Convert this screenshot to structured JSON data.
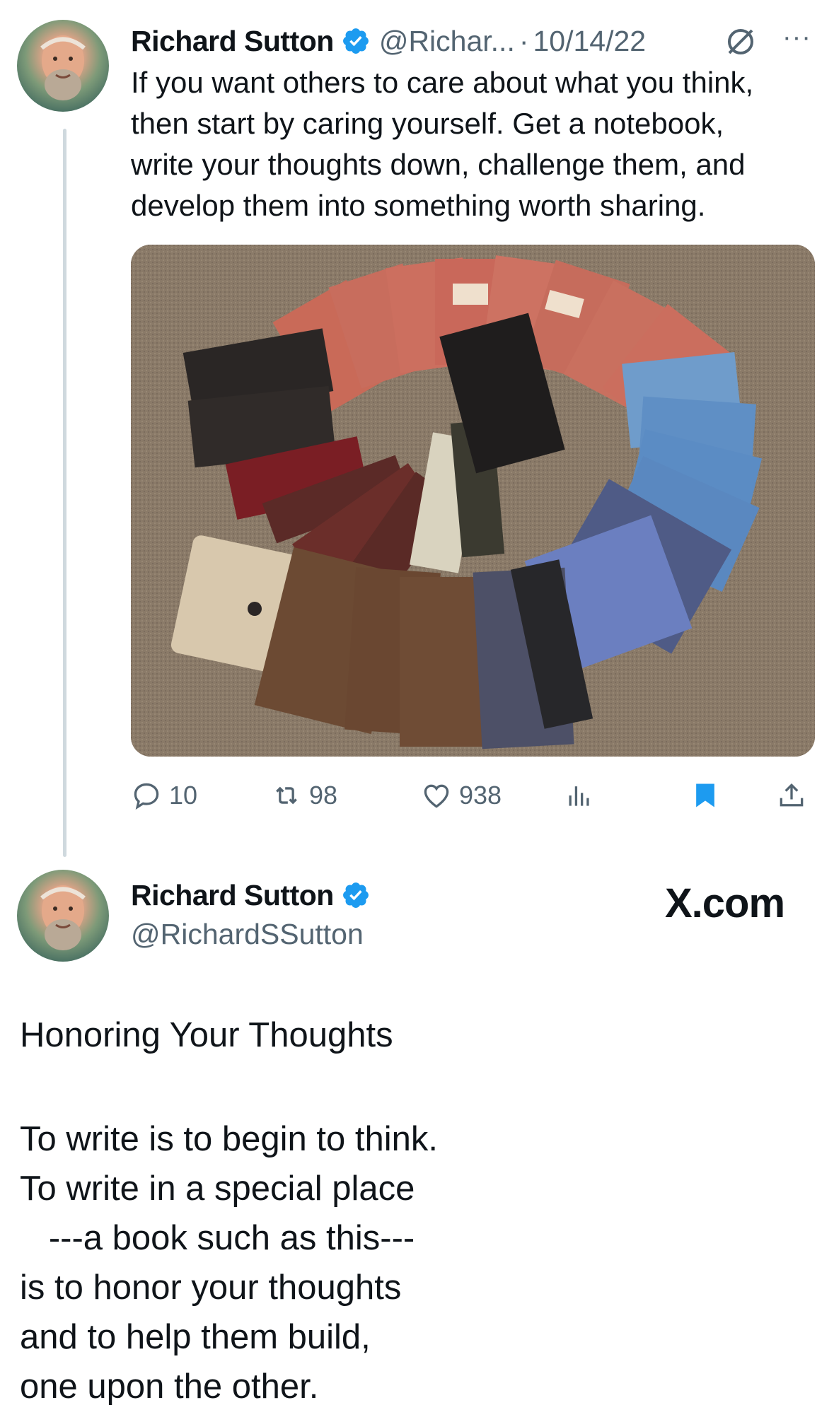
{
  "tweet": {
    "author_name": "Richard Sutton",
    "author_handle": "@Richar...",
    "separator": "·",
    "date": "10/14/22",
    "more_label": "···",
    "text": "If you want others to care about what you think,\nthen start by caring yourself. Get a notebook,\nwrite your thoughts down, challenge them, and\ndevelop them into something worth sharing.",
    "media_description_icon": "photo-of-notebooks-arranged-in-spiral",
    "actions": {
      "replies": "10",
      "reposts": "98",
      "likes": "938"
    }
  },
  "card": {
    "author_name": "Richard Sutton",
    "author_handle": "@RichardSSutton",
    "brand": "X.com"
  },
  "note": {
    "title": "Honoring Your Thoughts",
    "poem": "To write is to begin to think.\nTo write in a special place\n   ---a book such as this---\nis to honor your thoughts\nand to help them build,\none upon the other."
  },
  "colors": {
    "verified": "#1d9bf0",
    "muted": "#536471",
    "bookmark": "#1d9bf0",
    "thread_line": "#cfd9de"
  }
}
